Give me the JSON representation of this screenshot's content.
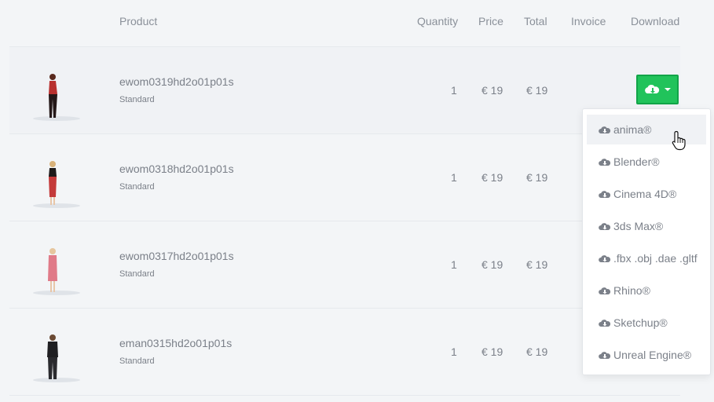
{
  "header": {
    "product": "Product",
    "quantity": "Quantity",
    "price": "Price",
    "total": "Total",
    "invoice": "Invoice",
    "download": "Download"
  },
  "rows": [
    {
      "name": "ewom0319hd2o01p01s",
      "type": "Standard",
      "quantity": "1",
      "price": "€ 19",
      "total": "€ 19",
      "figure_color": "#2a1a1a",
      "accent_color": "#b8312f"
    },
    {
      "name": "ewom0318hd2o01p01s",
      "type": "Standard",
      "quantity": "1",
      "price": "€ 19",
      "total": "€ 19",
      "figure_color": "#2b1d1d",
      "accent_color": "#c43a3a"
    },
    {
      "name": "ewom0317hd2o01p01s",
      "type": "Standard",
      "quantity": "1",
      "price": "€ 19",
      "total": "€ 19",
      "figure_color": "#e07a88",
      "accent_color": "#e07a88"
    },
    {
      "name": "eman0315hd2o01p01s",
      "type": "Standard",
      "quantity": "1",
      "price": "€ 19",
      "total": "€ 19",
      "figure_color": "#1f1f22",
      "accent_color": "#2a2a2e"
    }
  ],
  "download_menu": {
    "items": [
      "anima®",
      "Blender®",
      "Cinema 4D®",
      "3ds Max®",
      ".fbx .obj .dae .gltf",
      "Rhino®",
      "Sketchup®",
      "Unreal Engine®"
    ],
    "active_index": 0,
    "icon": "cloud-download-icon"
  },
  "colors": {
    "download_button": "#21c35b",
    "background": "#f3f5f7"
  }
}
